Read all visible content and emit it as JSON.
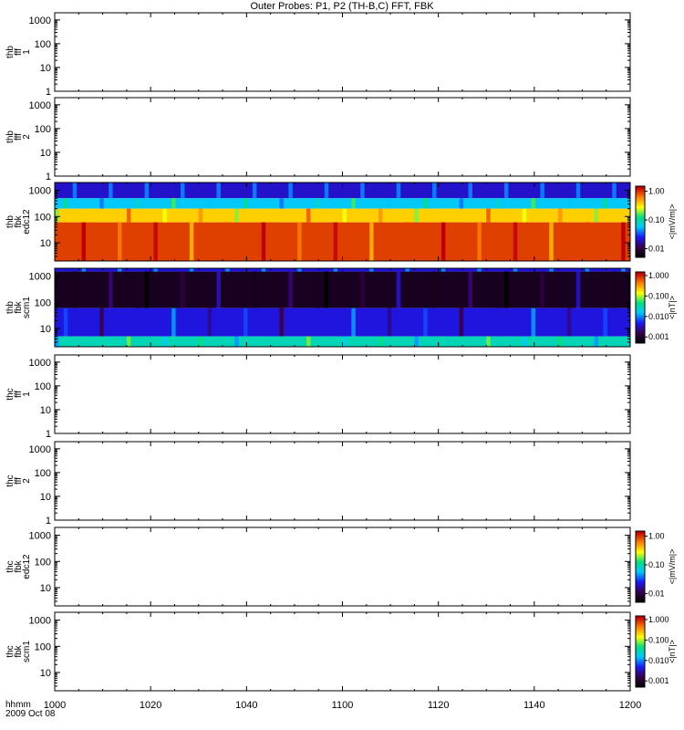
{
  "title": "Outer Probes: P1, P2 (TH-B,C) FFT, FBK",
  "time_axis": {
    "ticks": [
      "1000",
      "1020",
      "1040",
      "1100",
      "1120",
      "1140",
      "1200"
    ],
    "label": "hhmm",
    "date": "2009 Oct 08"
  },
  "colors": {
    "spectrogram_ramp": [
      "#000000",
      "#3a0050",
      "#1a1aff",
      "#00c8ff",
      "#00e080",
      "#ffff00",
      "#ff8000",
      "#c00000"
    ]
  },
  "chart_data": [
    {
      "type": "heatmap",
      "panel_label": [
        "thb",
        "fff",
        "1"
      ],
      "yscale": "log",
      "ylim": [
        1,
        2000
      ],
      "yticks": [
        "1",
        "10",
        "100",
        "1000"
      ],
      "has_data": false,
      "colorbar": null
    },
    {
      "type": "heatmap",
      "panel_label": [
        "thb",
        "fff",
        "2"
      ],
      "yscale": "log",
      "ylim": [
        1,
        2000
      ],
      "yticks": [
        "1",
        "10",
        "100",
        "1000"
      ],
      "has_data": false,
      "colorbar": null
    },
    {
      "type": "heatmap",
      "panel_label": [
        "thb",
        "fbk",
        "edc12"
      ],
      "yscale": "log",
      "ylim": [
        2,
        2000
      ],
      "yticks": [
        "10",
        "100",
        "1000"
      ],
      "has_data": true,
      "bands": [
        {
          "range": [
            500,
            2000
          ],
          "level": 0.02
        },
        {
          "range": [
            200,
            500
          ],
          "level": 0.06
        },
        {
          "range": [
            60,
            200
          ],
          "level": 0.4
        },
        {
          "range": [
            2,
            60
          ],
          "level": 1.0
        }
      ],
      "colorbar": {
        "label": "<|mV/m|>",
        "ticks": [
          "1.00",
          "0.10",
          "0.01"
        ],
        "range": [
          0.005,
          1.5
        ],
        "scale": "log"
      }
    },
    {
      "type": "heatmap",
      "panel_label": [
        "thb",
        "fbk",
        "scm1"
      ],
      "yscale": "log",
      "ylim": [
        2,
        2000
      ],
      "yticks": [
        "10",
        "100",
        "1000"
      ],
      "has_data": true,
      "bands": [
        {
          "range": [
            1500,
            2000
          ],
          "level": 0.004
        },
        {
          "range": [
            60,
            1500
          ],
          "level": 0.0008
        },
        {
          "range": [
            5,
            60
          ],
          "level": 0.004
        },
        {
          "range": [
            2,
            5
          ],
          "level": 0.03
        }
      ],
      "colorbar": {
        "label": "<|nT|>",
        "ticks": [
          "1.000",
          "0.100",
          "0.010",
          "0.001"
        ],
        "range": [
          0.0005,
          1.5
        ],
        "scale": "log"
      }
    },
    {
      "type": "heatmap",
      "panel_label": [
        "thc",
        "fff",
        "1"
      ],
      "yscale": "log",
      "ylim": [
        1,
        2000
      ],
      "yticks": [
        "1",
        "10",
        "100",
        "1000"
      ],
      "has_data": false,
      "colorbar": null
    },
    {
      "type": "heatmap",
      "panel_label": [
        "thc",
        "fff",
        "2"
      ],
      "yscale": "log",
      "ylim": [
        1,
        2000
      ],
      "yticks": [
        "1",
        "10",
        "100",
        "1000"
      ],
      "has_data": false,
      "colorbar": null
    },
    {
      "type": "heatmap",
      "panel_label": [
        "thc",
        "fbk",
        "edc12"
      ],
      "yscale": "log",
      "ylim": [
        2,
        2000
      ],
      "yticks": [
        "10",
        "100",
        "1000"
      ],
      "has_data": false,
      "colorbar": {
        "label": "<|mV/m|>",
        "ticks": [
          "1.00",
          "0.10",
          "0.01"
        ],
        "range": [
          0.005,
          1.5
        ],
        "scale": "log"
      }
    },
    {
      "type": "heatmap",
      "panel_label": [
        "thc",
        "fbk",
        "scm1"
      ],
      "yscale": "log",
      "ylim": [
        2,
        2000
      ],
      "yticks": [
        "10",
        "100",
        "1000"
      ],
      "has_data": false,
      "colorbar": {
        "label": "<|nT|>",
        "ticks": [
          "1.000",
          "0.100",
          "0.010",
          "0.001"
        ],
        "range": [
          0.0005,
          1.5
        ],
        "scale": "log"
      }
    }
  ]
}
